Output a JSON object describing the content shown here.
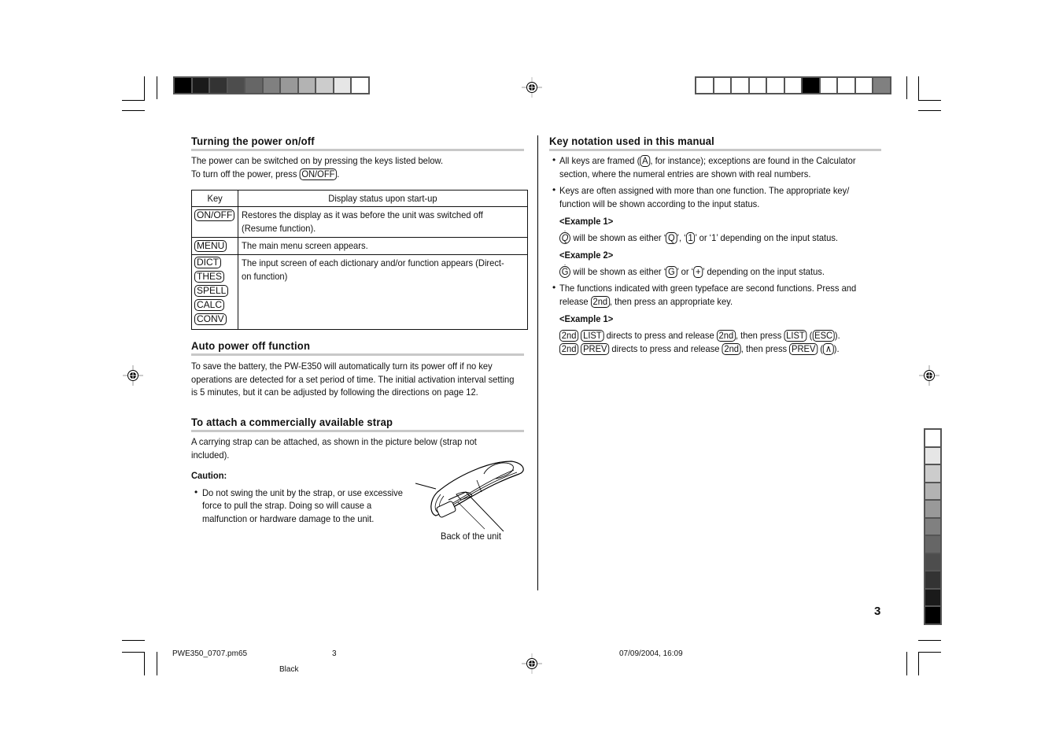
{
  "color_bars": {
    "top_left": [
      "#000000",
      "#1a1a1a",
      "#333333",
      "#4d4d4d",
      "#666666",
      "#808080",
      "#999999",
      "#b3b3b3",
      "#cccccc",
      "#e6e6e6",
      "#ffffff"
    ],
    "top_right": [
      "#ffffff",
      "#ffffff",
      "#ffffff",
      "#ffffff",
      "#ffffff",
      "#ffffff",
      "#000000",
      "#ffffff",
      "#ffffff",
      "#ffffff",
      "#808080"
    ],
    "right_vertical": [
      "#ffffff",
      "#e6e6e6",
      "#cccccc",
      "#b3b3b3",
      "#999999",
      "#808080",
      "#666666",
      "#4d4d4d",
      "#333333",
      "#1a1a1a",
      "#000000"
    ]
  },
  "left": {
    "power": {
      "title": "Turning the power on/off",
      "line1": "The power can be switched on by pressing the keys listed below.",
      "line2_pre": "To turn off the power, press ",
      "line2_key": "ON/OFF",
      "line2_post": ".",
      "table": {
        "headers": [
          "Key",
          "Display status upon start-up"
        ],
        "rows": [
          {
            "keys": [
              "ON/OFF"
            ],
            "text1": "Restores the display as it was before the unit was switched off",
            "text2": "(Resume function)."
          },
          {
            "keys": [
              "MENU"
            ],
            "text1": "The main menu screen appears.",
            "text2": ""
          },
          {
            "keys": [
              "DICT",
              "THES",
              "SPELL",
              "CALC",
              "CONV"
            ],
            "text1": "The input screen of each dictionary and/or function appears (Direct-",
            "text2": "on function)"
          }
        ]
      }
    },
    "auto_off": {
      "title": "Auto power off function",
      "lines": [
        "To save the battery, the PW-E350 will automatically turn its power off if no key",
        "operations are detected for a set period of time. The initial activation interval setting",
        "is 5 minutes, but it can be adjusted by following the directions on page 12."
      ]
    },
    "strap": {
      "title": "To attach a commercially available strap",
      "lines": [
        "A carrying strap can be attached, as shown in the picture below (strap not",
        "included)."
      ],
      "caution_label": "Caution:",
      "caution_lines": [
        "Do not swing the unit by the strap, or use excessive",
        "force to pull the strap. Doing so will cause a",
        "malfunction or hardware damage to the unit."
      ],
      "figure_caption": "Back of the unit"
    }
  },
  "right": {
    "title": "Key notation used in this manual",
    "b1_l1_pre": "All keys are framed (",
    "b1_key": "A",
    "b1_l1_post": ", for instance); exceptions are found in the Calculator",
    "b1_l2": "section, where the numeral entries are shown with real numbers.",
    "b2_l1": "Keys are often assigned with more than one function. The appropriate key/",
    "b2_l2": "function will be shown according to the input status.",
    "ex1_label": "<Example 1>",
    "ex1_key": "Q",
    "ex1_a": " will be shown as either ‘",
    "ex1_k2": "Q",
    "ex1_b": "’, ‘",
    "ex1_k3": "1",
    "ex1_c": "’ or ‘1’ depending on the input status.",
    "ex2_label": "<Example 2>",
    "ex2_key": "G",
    "ex2_a": " will be shown as either ‘",
    "ex2_k2": "G",
    "ex2_b": "’ or ‘",
    "ex2_k3": "+",
    "ex2_c": "’ depending on the input status.",
    "b3_l1": "The functions indicated with green typeface are second functions. Press and",
    "b3_l2_pre": "release ",
    "b3_key": "2nd",
    "b3_l2_post": ", then press an appropriate key.",
    "ex3_label": "<Example 1>",
    "ex3_line1": {
      "k1": "2nd",
      "k2": "LIST",
      "t1": " directs to press and release ",
      "k3": "2nd",
      "t2": ", then press ",
      "k4": "LIST",
      "t3": " (",
      "k5": "ESC",
      "t4": ")."
    },
    "ex3_line2": {
      "k1": "2nd",
      "k2": "PREV",
      "t1": " directs to press and release ",
      "k3": "2nd",
      "t2": ", then press ",
      "k4": "PREV",
      "t3": " (",
      "k5": "∧",
      "t4": ")."
    }
  },
  "page_number": "3",
  "footer": {
    "filename": "PWE350_0707.pm65",
    "page": "3",
    "plate": "Black",
    "datetime": "07/09/2004, 16:09"
  }
}
